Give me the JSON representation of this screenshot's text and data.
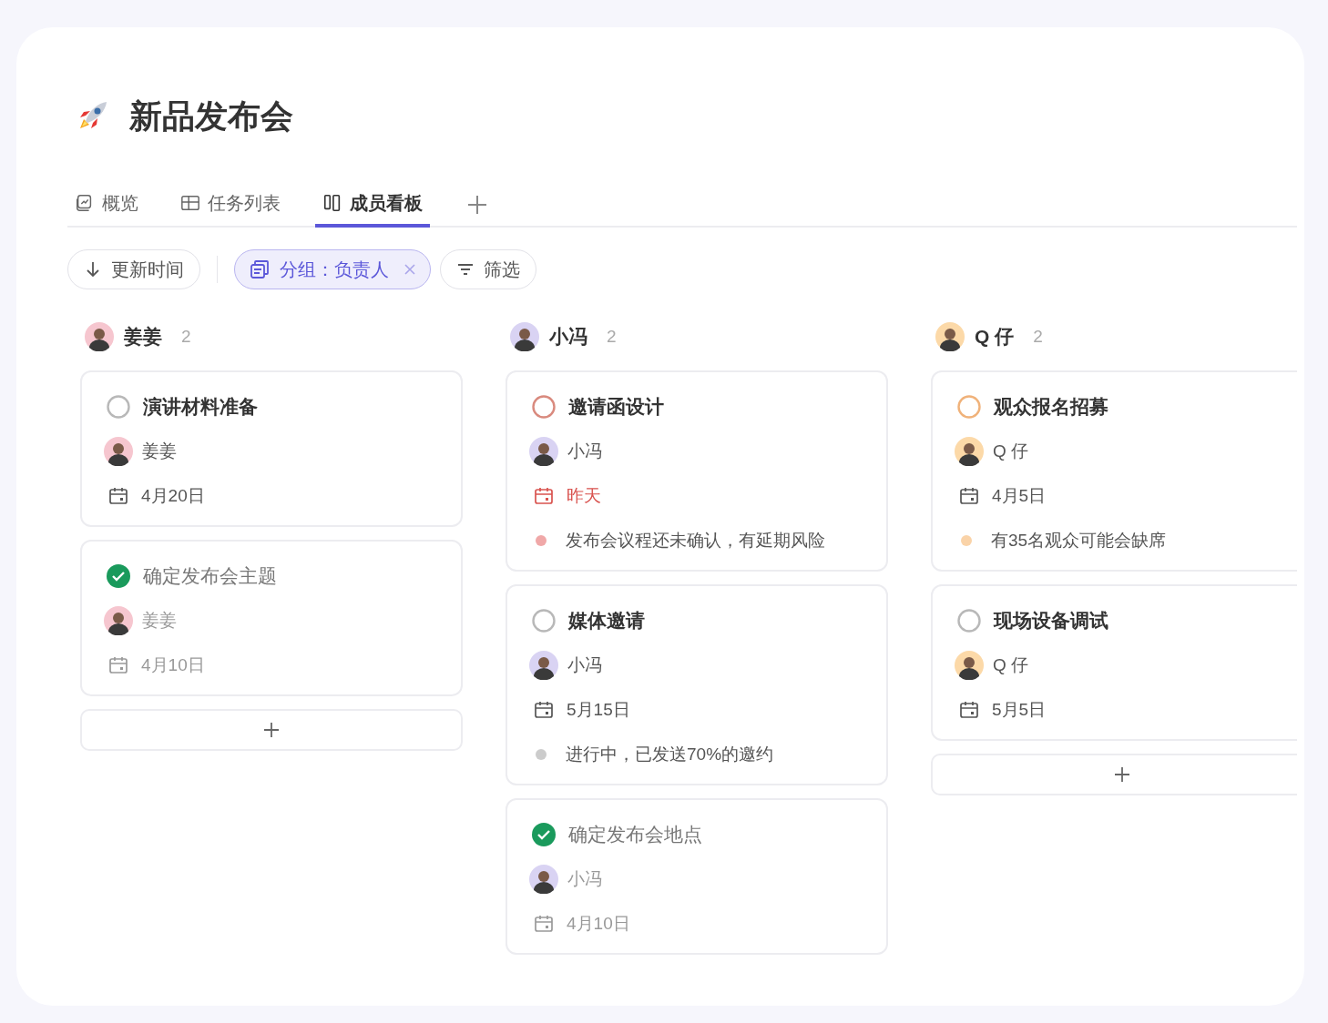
{
  "title": "新品发布会",
  "tabs": [
    {
      "label": "概览",
      "kind": "overview",
      "selected": false
    },
    {
      "label": "任务列表",
      "kind": "table",
      "selected": false
    },
    {
      "label": "成员看板",
      "kind": "board",
      "selected": true
    }
  ],
  "toolbar": {
    "sort": "更新时间",
    "group": "分组：负责人",
    "filter": "筛选"
  },
  "columns": [
    {
      "name": "姜姜",
      "count": "2",
      "color": "#f6c6cf",
      "add_button": true,
      "tasks": [
        {
          "title": "演讲材料准备",
          "done": false,
          "color": "#b8b8b8",
          "assignee": "姜姜",
          "date": "4月20日",
          "overdue": false
        },
        {
          "title": "确定发布会主题",
          "done": true,
          "color": "#1a9a5c",
          "assignee": "姜姜",
          "date": "4月10日",
          "overdue": false
        }
      ]
    },
    {
      "name": "小冯",
      "count": "2",
      "color": "#d9d3f3",
      "tasks": [
        {
          "title": "邀请函设计",
          "done": false,
          "color": "#d98a7e",
          "assignee": "小冯",
          "date": "昨天",
          "overdue": true,
          "note": {
            "text": "发布会议程还未确认，有延期风险",
            "color": "#f0a8a8"
          }
        },
        {
          "title": "媒体邀请",
          "done": false,
          "color": "#b8b8b8",
          "assignee": "小冯",
          "date": "5月15日",
          "overdue": false,
          "note": {
            "text": "进行中，已发送70%的邀约",
            "color": "#cccccc"
          }
        },
        {
          "title": "确定发布会地点",
          "done": true,
          "color": "#1a9a5c",
          "assignee": "小冯",
          "date": "4月10日",
          "overdue": false
        }
      ]
    },
    {
      "name": "Q 仔",
      "count": "2",
      "color": "#fcd9a8",
      "add_button": true,
      "tasks": [
        {
          "title": "观众报名招募",
          "done": false,
          "color": "#f0b27a",
          "assignee": "Q 仔",
          "date": "4月5日",
          "overdue": false,
          "note": {
            "text": "有35名观众可能会缺席",
            "color": "#fad3a8"
          }
        },
        {
          "title": "现场设备调试",
          "done": false,
          "color": "#b8b8b8",
          "assignee": "Q 仔",
          "date": "5月5日",
          "overdue": false
        }
      ]
    }
  ]
}
